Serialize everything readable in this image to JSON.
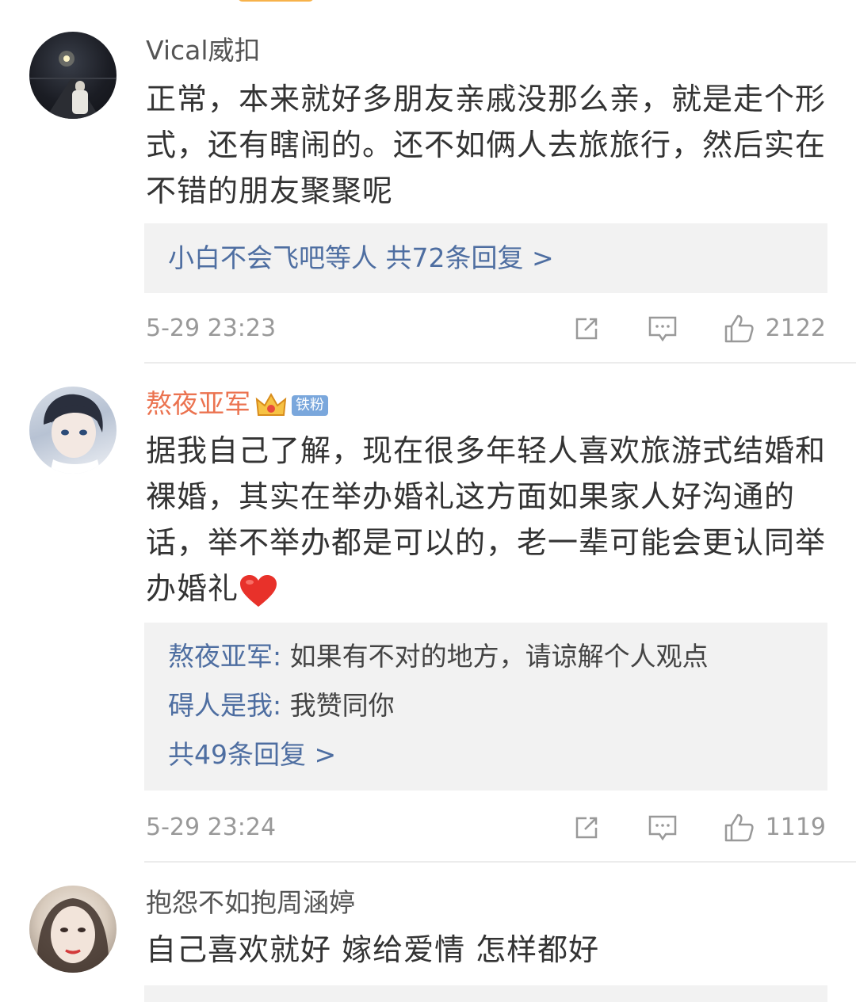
{
  "comments": [
    {
      "username": "Vical威扣",
      "text": "正常，本来就好多朋友亲戚没那么亲，就是走个形式，还有瞎闹的。还不如俩人去旅旅行，然后实在不错的朋友聚聚呢",
      "replies_summary": "小白不会飞吧等人  共72条回复 >",
      "time": "5-29 23:23",
      "likes": "2122",
      "actions": [
        "share-icon",
        "comment-icon",
        "like-icon"
      ]
    },
    {
      "username": "熬夜亚军",
      "badge": "铁粉",
      "badge_icon": "crown-icon",
      "text": "据我自己了解，现在很多年轻人喜欢旅游式结婚和裸婚，其实在举办婚礼这方面如果家人好沟通的话，举不举办都是可以的，老一辈可能会更认同举办婚礼",
      "text_emoji": "heart-icon",
      "replies": [
        {
          "user": "熬夜亚军:",
          "text": " 如果有不对的地方，请谅解个人观点"
        },
        {
          "user": "碍人是我:",
          "text": " 我赞同你"
        }
      ],
      "replies_more": "共49条回复 >",
      "time": "5-29 23:24",
      "likes": "1119",
      "actions": [
        "share-icon",
        "comment-icon",
        "like-icon"
      ]
    },
    {
      "username": "抱怨不如抱周涵婷",
      "text": "自己喜欢就好 嫁给爱情 怎样都好"
    }
  ],
  "colors": {
    "username_default": "#555555",
    "username_vip": "#eb7350",
    "link": "#4e6ea1",
    "meta": "#999999",
    "reply_bg": "#f2f2f2"
  }
}
